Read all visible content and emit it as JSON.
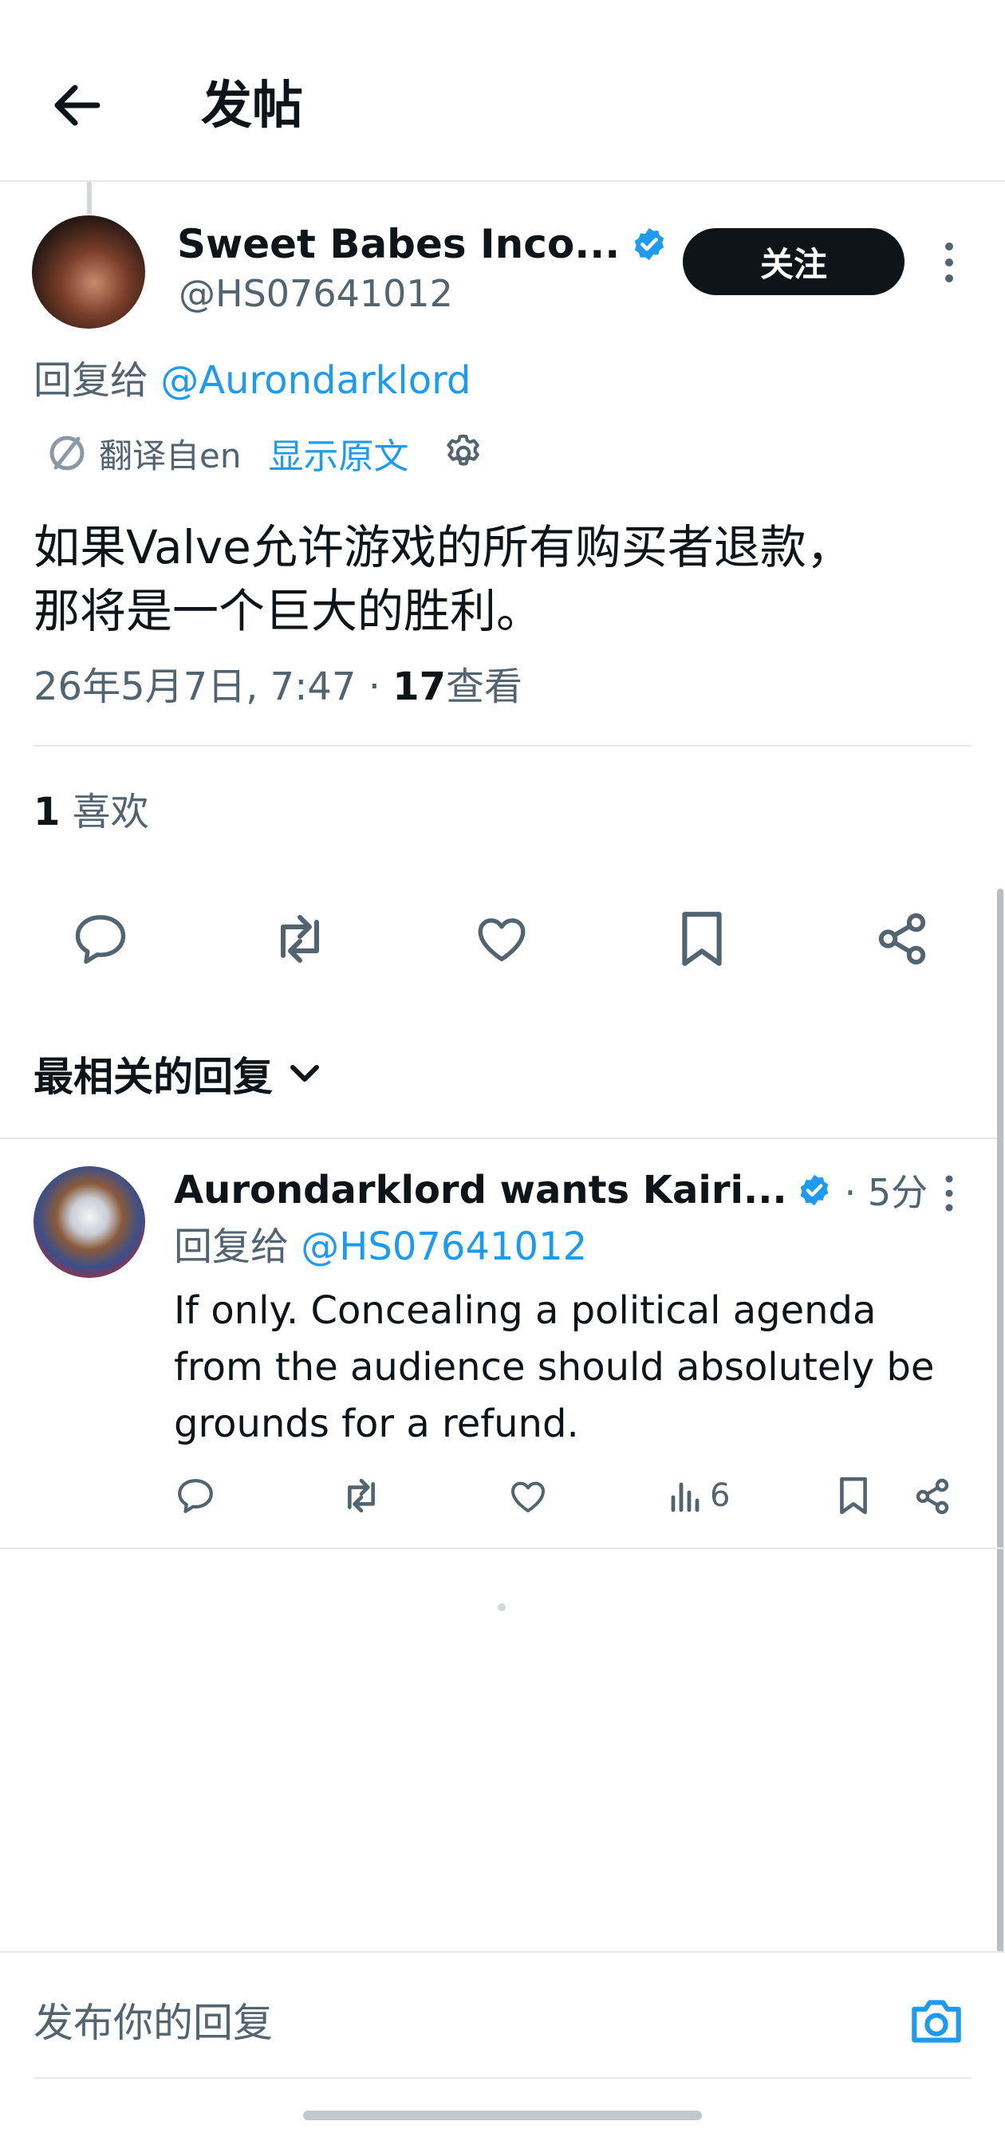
{
  "header": {
    "title": "发帖",
    "back_icon": "arrow-left-icon"
  },
  "post": {
    "display_name": "Sweet Babes Inco...",
    "handle": "@HS07641012",
    "follow_label": "关注",
    "reply_to_prefix": "回复给",
    "reply_to_user": "@Aurondarklord",
    "translated_from": "翻译自en",
    "show_original": "显示原文",
    "body": "如果Valve允许游戏的所有购买者退款，\n那将是一个巨大的胜利。",
    "timestamp": "26年5月7日, 7:47 · ",
    "view_count": "17",
    "view_label": "查看",
    "like_count": "1",
    "like_label": "喜欢"
  },
  "replies_sort": {
    "label": "最相关的回复"
  },
  "reply": {
    "display_name": "Aurondarklord wants Kairi...",
    "time": "· 5分",
    "reply_to_prefix": "回复给",
    "reply_to_user": "@HS07641012",
    "body": "If only.  Concealing a political agenda from the audience should absolutely be grounds for a refund.",
    "views": "6"
  },
  "composer": {
    "placeholder": "发布你的回复"
  },
  "colors": {
    "accent": "#1d9bf0",
    "text": "#0f1419",
    "muted": "#536471",
    "divider": "#e6e9ec"
  }
}
